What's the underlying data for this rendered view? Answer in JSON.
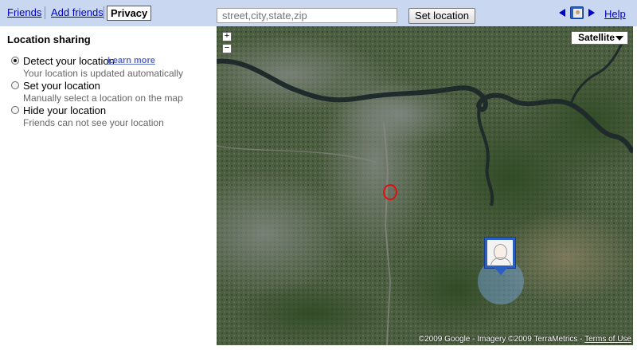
{
  "tabs": [
    {
      "label": "Friends",
      "selected": false
    },
    {
      "label": "Add friends",
      "selected": false
    },
    {
      "label": "Privacy",
      "selected": true
    }
  ],
  "search": {
    "placeholder": "street,city,state,zip",
    "button_label": "Set location"
  },
  "header": {
    "nav_icons": [
      "arrow-left-icon",
      "user-photo-icon",
      "arrow-right-icon"
    ],
    "help_link": "Help"
  },
  "sidebar": {
    "title": "Location sharing",
    "options": [
      {
        "label": "Detect your location",
        "link": "Learn more",
        "description": "Your location is updated automatically",
        "selected": true
      },
      {
        "label": "Set your location",
        "description": "Manually select a location on the map",
        "selected": false
      },
      {
        "label": "Hide your location",
        "description": "Friends can not see your location",
        "selected": false
      }
    ]
  },
  "map": {
    "view": "Satellite",
    "zoom_in": "+",
    "zoom_out": "−",
    "attribution": "©2009 Google - Imagery ©2009 TerraMetrics - ",
    "terms_link": "Terms of Use"
  },
  "colors": {
    "top_bar": "#c9d7f1",
    "link": "#0000cc",
    "marker_blue": "#2a5fc1",
    "highlight_red": "#e01010"
  }
}
